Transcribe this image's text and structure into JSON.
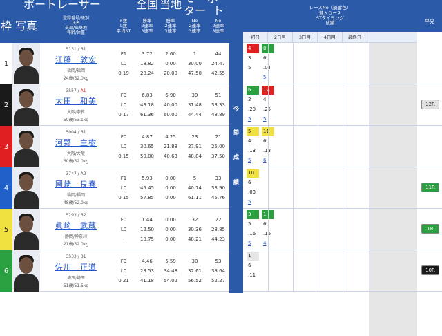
{
  "header": {
    "left_title": "ボートレーサー",
    "wakulabel": "枠",
    "photo": "写真",
    "regcol": "登録番号/級別\n氏名\n支部/出身地\n年齢/体重",
    "fcol": "F数\nL数\n平均ST",
    "zenkoku": "全国",
    "tochi": "当地",
    "motor": "モーター",
    "boat": "ボート",
    "rate": "勝率\n2連率\n3連率",
    "norate": "No\n2連率\n3連率",
    "race_title": "レースNo（艇番色）\n進入コース\nSTタイミング\n成績",
    "days": [
      "初日",
      "2日目",
      "3日目",
      "4日目",
      "最終日"
    ],
    "early": "早見",
    "vertical": [
      "今",
      "節",
      "成",
      "績"
    ]
  },
  "racers": [
    {
      "waku": "1",
      "num": "5131 / B1",
      "cls": "",
      "name": "江藤　敦宏",
      "branch": "福岡/福岡",
      "age": "24歳/52.0kg",
      "f": [
        "F1",
        "L0",
        "0.19"
      ],
      "z": [
        "3.72",
        "18.82",
        "28.24"
      ],
      "t": [
        "2.60",
        "0.00",
        "20.00"
      ],
      "m": [
        "1",
        "30.00",
        "47.50"
      ],
      "b": [
        "44",
        "24.47",
        "42.55"
      ],
      "r": [
        {
          "d": [
            {
              "n": "4",
              "c": "#e02020",
              "w": "#fff"
            },
            "3",
            "5",
            ""
          ],
          "e": [
            {
              "n": "8",
              "c": "#2aa040",
              "w": "#fff"
            },
            "6",
            ".04",
            "5"
          ]
        }
      ],
      "early": ""
    },
    {
      "waku": "2",
      "num": "3557 / ",
      "cls": "A1",
      "name": "太田　和美",
      "branch": "大阪/奈良",
      "age": "50歳/53.1kg",
      "f": [
        "F0",
        "L0",
        "0.17"
      ],
      "z": [
        "6.83",
        "43.18",
        "61.36"
      ],
      "t": [
        "6.90",
        "40.00",
        "60.00"
      ],
      "m": [
        "39",
        "31.48",
        "44.44"
      ],
      "b": [
        "51",
        "33.33",
        "48.89"
      ],
      "r": [
        {
          "d": [
            {
              "n": "6",
              "c": "#2aa040",
              "w": "#fff"
            },
            "2",
            ".20",
            "5"
          ],
          "e": [
            {
              "n": "12",
              "c": "#e02020",
              "w": "#fff"
            },
            "4",
            ".25",
            "5"
          ]
        }
      ],
      "early": "12R"
    },
    {
      "waku": "3",
      "num": "5004 / B1",
      "cls": "",
      "name": "河野　主樹",
      "branch": "大阪/大阪",
      "age": "30歳/52.0kg",
      "f": [
        "F0",
        "L0",
        "0.15"
      ],
      "z": [
        "4.87",
        "30.65",
        "50.00"
      ],
      "t": [
        "4.25",
        "21.88",
        "40.63"
      ],
      "m": [
        "23",
        "27.91",
        "48.84"
      ],
      "b": [
        "21",
        "25.00",
        "37.50"
      ],
      "r": [
        {
          "d": [
            {
              "n": "5",
              "c": "#f0e040",
              "w": "#222"
            },
            "4",
            ".13",
            "5"
          ],
          "e": [
            {
              "n": "11",
              "c": "#f0e040",
              "w": "#222"
            },
            "6",
            ".13",
            "6"
          ]
        }
      ],
      "early": ""
    },
    {
      "waku": "4",
      "num": "3747 / A2",
      "cls": "",
      "name": "國崎　良春",
      "branch": "福岡/福岡",
      "age": "48歳/52.0kg",
      "f": [
        "F1",
        "L0",
        "0.15"
      ],
      "z": [
        "5.93",
        "45.45",
        "57.85"
      ],
      "t": [
        "0.00",
        "0.00",
        "0.00"
      ],
      "m": [
        "5",
        "40.74",
        "61.11"
      ],
      "b": [
        "33",
        "33.90",
        "45.76"
      ],
      "r": [
        {
          "d": [
            {
              "n": "10",
              "c": "#f0e040",
              "w": "#222"
            },
            "6",
            ".03",
            "5"
          ],
          "e": [
            {
              "n": "",
              "c": "",
              "w": ""
            },
            "",
            "",
            ""
          ]
        }
      ],
      "early": "11R"
    },
    {
      "waku": "5",
      "num": "5293 / B2",
      "cls": "",
      "name": "眞崎　武蔵",
      "branch": "静岡/神奈川",
      "age": "21歳/52.0kg",
      "f": [
        "F0",
        "L0",
        "-"
      ],
      "z": [
        "1.44",
        "12.50",
        "18.75"
      ],
      "t": [
        "0.00",
        "0.00",
        "0.00"
      ],
      "m": [
        "32",
        "30.36",
        "48.21"
      ],
      "b": [
        "22",
        "28.85",
        "44.23"
      ],
      "r": [
        {
          "d": [
            {
              "n": "3",
              "c": "#2aa040",
              "w": "#fff"
            },
            "5",
            ".16",
            "5"
          ],
          "e": [
            {
              "n": "1",
              "c": "#2aa040",
              "w": "#fff"
            },
            "6",
            ".16",
            "4"
          ]
        }
      ],
      "early": "1R"
    },
    {
      "waku": "6",
      "num": "3533 / B1",
      "cls": "",
      "name": "佐川　正道",
      "branch": "埼玉/埼玉",
      "age": "51歳/51.5kg",
      "f": [
        "F0",
        "L0",
        "0.21"
      ],
      "z": [
        "4.46",
        "23.53",
        "41.18"
      ],
      "t": [
        "5.59",
        "34.48",
        "54.02"
      ],
      "m": [
        "30",
        "32.61",
        "56.52"
      ],
      "b": [
        "53",
        "38.64",
        "52.27"
      ],
      "r": [
        {
          "d": [
            {
              "n": "1",
              "c": "#e6e6e6",
              "w": "#222"
            },
            "6",
            ".11",
            ""
          ],
          "e": [
            {
              "n": "",
              "c": "",
              "w": ""
            },
            "",
            "",
            ""
          ]
        }
      ],
      "early": "10R"
    }
  ],
  "colors": {
    "header": "#2b5aa8",
    "waku": [
      "#ffffff",
      "#1a1a1a",
      "#e02020",
      "#2060c8",
      "#f0e040",
      "#2aa040"
    ],
    "wakutext": [
      "#222",
      "#fff",
      "#fff",
      "#fff",
      "#222",
      "#fff"
    ],
    "earlybg": {
      "12R": "#e0e0e0",
      "11R": "#2aa040",
      "1R": "#2aa040",
      "10R": "#1a1a1a"
    },
    "earlytext": {
      "12R": "#333",
      "11R": "#fff",
      "1R": "#fff",
      "10R": "#fff"
    }
  }
}
